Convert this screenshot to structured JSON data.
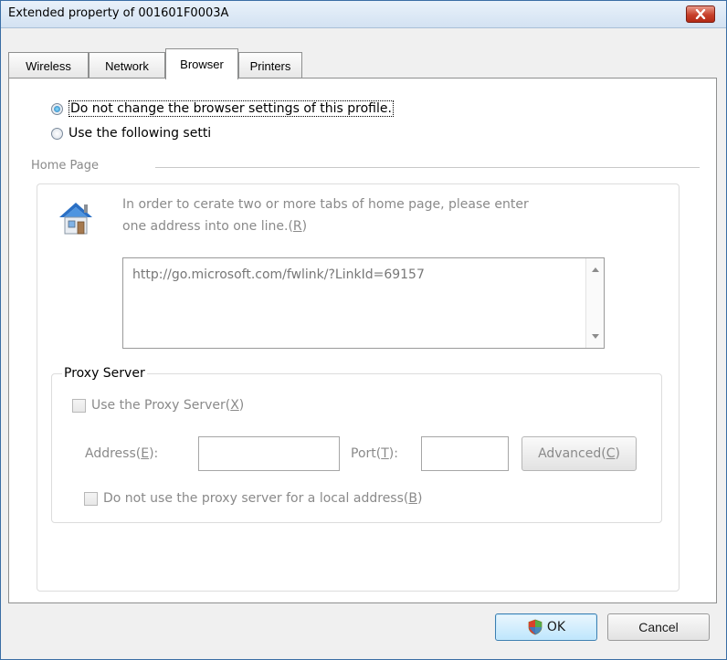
{
  "window": {
    "title": "Extended property of 001601F0003A",
    "close_icon": "close-x-icon"
  },
  "tabs": [
    {
      "label": "Wireless",
      "active": false
    },
    {
      "label": "Network",
      "active": false
    },
    {
      "label": "Browser",
      "active": true
    },
    {
      "label": "Printers",
      "active": false
    }
  ],
  "browser": {
    "radio_keep": "Do not change the browser settings of this profile.",
    "radio_use": "Use the following setti",
    "selected": "radio_keep",
    "home_page": {
      "title": "Home Page",
      "icon": "house-icon",
      "hint_line1": "In order to cerate two or more tabs of home page, please enter",
      "hint_line2_pre": "one address into one line.(",
      "hint_line2_key": "R",
      "hint_line2_post": ")",
      "url": "http://go.microsoft.com/fwlink/?LinkId=69157"
    },
    "proxy": {
      "title": "Proxy Server",
      "use_pre": "Use the Proxy Server(",
      "use_key": "X",
      "use_post": ")",
      "address_pre": "Address(",
      "address_key": "E",
      "address_post": "):",
      "address_value": "",
      "port_pre": "Port(",
      "port_key": "T",
      "port_post": "):",
      "port_value": "",
      "advanced_pre": "Advanced(",
      "advanced_key": "C",
      "advanced_post": ")",
      "bypass_pre": "Do not use the proxy server for a local address(",
      "bypass_key": "B",
      "bypass_post": ")"
    }
  },
  "footer": {
    "ok_label": "OK",
    "ok_icon": "shield-icon",
    "cancel_label": "Cancel"
  }
}
